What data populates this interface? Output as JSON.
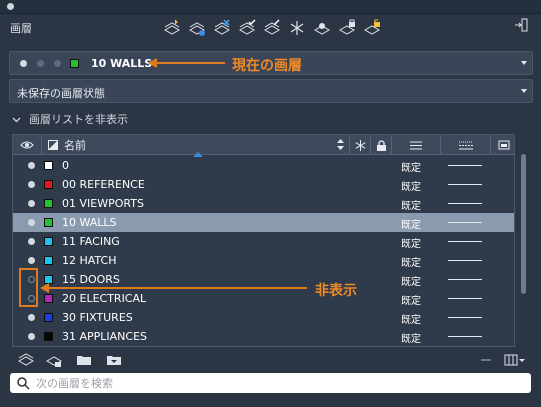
{
  "panel": {
    "title": "画層"
  },
  "toolbar": {
    "icons": [
      "new-layer-icon",
      "new-layer-vp-frozen-icon",
      "delete-layer-icon",
      "set-current-icon",
      "layer-settings-icon",
      "freeze-icon",
      "isolate-icon",
      "lock-icon",
      "unlock-icon"
    ]
  },
  "current_layer": {
    "name": "10 WALLS",
    "swatch_color": "#22c233"
  },
  "annotations": {
    "current_layer": "現在の画層",
    "hidden": "非表示",
    "color": "#e07a1f"
  },
  "layer_state": {
    "value": "未保存の画層状態"
  },
  "toggle_list": {
    "label": "画層リストを非表示"
  },
  "columns": {
    "name": "名前"
  },
  "layers": [
    {
      "name": "0",
      "color": "#ffffff",
      "on": true,
      "linetype": "既定"
    },
    {
      "name": "00 REFERENCE",
      "color": "#e21a1a",
      "on": true,
      "linetype": "既定"
    },
    {
      "name": "01 VIEWPORTS",
      "color": "#22c233",
      "on": true,
      "linetype": "既定"
    },
    {
      "name": "10 WALLS",
      "color": "#22c233",
      "on": true,
      "linetype": "既定",
      "selected": true
    },
    {
      "name": "11 FACING",
      "color": "#1ec4f0",
      "on": true,
      "linetype": "既定"
    },
    {
      "name": "12 HATCH",
      "color": "#1ec4f0",
      "on": true,
      "linetype": "既定"
    },
    {
      "name": "15 DOORS",
      "color": "#1ec4f0",
      "on": false,
      "linetype": "既定"
    },
    {
      "name": "20 ELECTRICAL",
      "color": "#b328b8",
      "on": false,
      "linetype": "既定"
    },
    {
      "name": "30 FIXTURES",
      "color": "#1a3fe0",
      "on": true,
      "linetype": "既定"
    },
    {
      "name": "31 APPLIANCES",
      "color": "#050505",
      "on": true,
      "linetype": "既定"
    }
  ],
  "search": {
    "placeholder": "次の画層を検索"
  }
}
